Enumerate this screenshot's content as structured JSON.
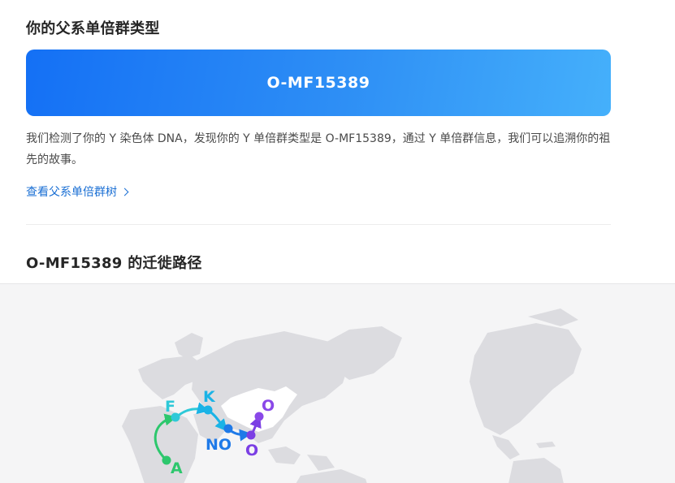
{
  "section1": {
    "title": "你的父系单倍群类型",
    "haplogroup": "O-MF15389",
    "description": "我们检测了你的 Y 染色体 DNA，发现你的 Y 单倍群类型是 O-MF15389，通过 Y 单倍群信息，我们可以追溯你的祖先的故事。",
    "link_label": "查看父系单倍群树"
  },
  "section2": {
    "title": "O-MF15389 的迁徙路径"
  },
  "migration": {
    "nodes": [
      {
        "label": "A",
        "color": "#2dc76d"
      },
      {
        "label": "F",
        "color": "#2ec9d8"
      },
      {
        "label": "K",
        "color": "#1ab3e6"
      },
      {
        "label": "NO",
        "color": "#1f7ae8"
      },
      {
        "label": "O",
        "color": "#7b3fe4"
      },
      {
        "label": "O",
        "color": "#8a48e8"
      }
    ],
    "colors": {
      "banner_start": "#1470f5",
      "banner_end": "#45b0fb",
      "link": "#1a6fd4",
      "land": "#dcdce0",
      "highlight_region": "#ffffff"
    }
  }
}
